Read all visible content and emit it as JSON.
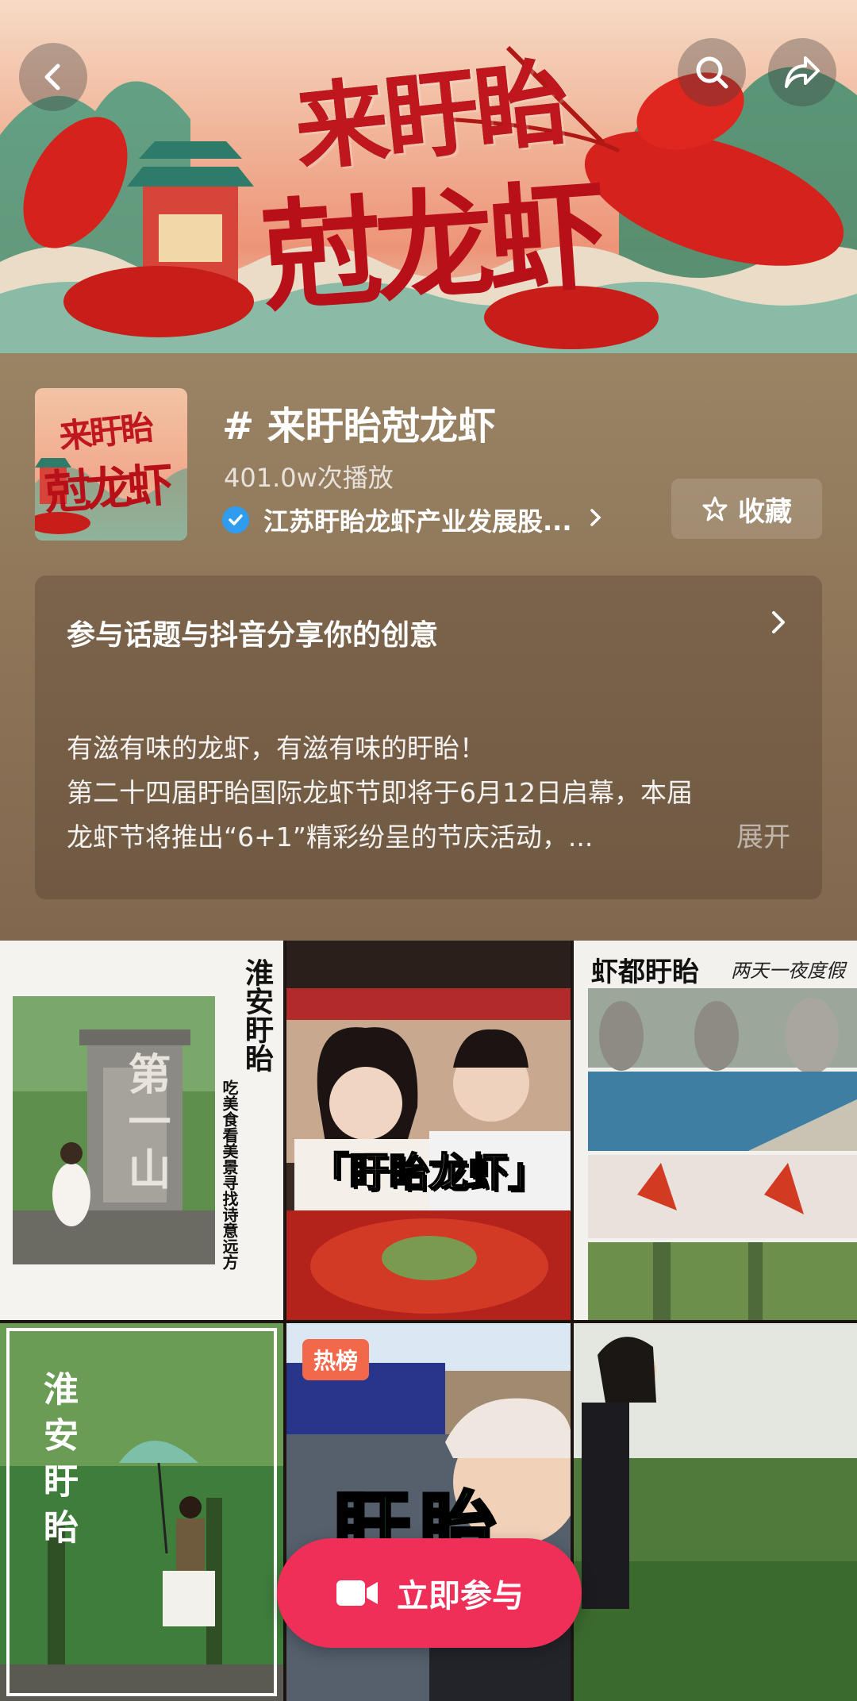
{
  "banner": {
    "art_line1": "来盱眙",
    "art_line2": "尅龙虾",
    "back_icon": "chevron-left-icon",
    "search_icon": "search-icon",
    "share_icon": "share-arrow-icon"
  },
  "topic": {
    "title": "# 来盱眙尅龙虾",
    "plays": "401.0w次播放",
    "organization": "江苏盱眙龙虾产业发展股...",
    "favorite_label": "收藏",
    "thumb_line1": "来盱眙",
    "thumb_line2": "尅龙虾"
  },
  "description": {
    "heading": "参与话题与抖音分享你的创意",
    "lines": [
      "有滋有味的龙虾，有滋有味的盱眙！",
      "第二十四届盱眙国际龙虾节即将于6月12日启幕，本届",
      "龙虾节将推出“6+1”精彩纷呈的节庆活动，..."
    ],
    "expand_label": "展开"
  },
  "grid": {
    "items": [
      {
        "title_vertical": "淮安盱眙",
        "subtitle_vertical": "吃美食看美景寻找诗意远方",
        "stone_text": "第一山"
      },
      {
        "caption": "「盱眙龙虾」"
      },
      {
        "title": "虾都盱眙",
        "tagline": "两天一夜度假"
      },
      {
        "title_vertical": "淮安盱眙"
      },
      {
        "badge": "热榜",
        "caption": "盱眙"
      },
      {}
    ]
  },
  "join_button": {
    "label": "立即参与"
  },
  "colors": {
    "accent": "#ef2f57",
    "panel": "#8f7659",
    "verified": "#2f9cf0",
    "badge": "#f2684a"
  }
}
